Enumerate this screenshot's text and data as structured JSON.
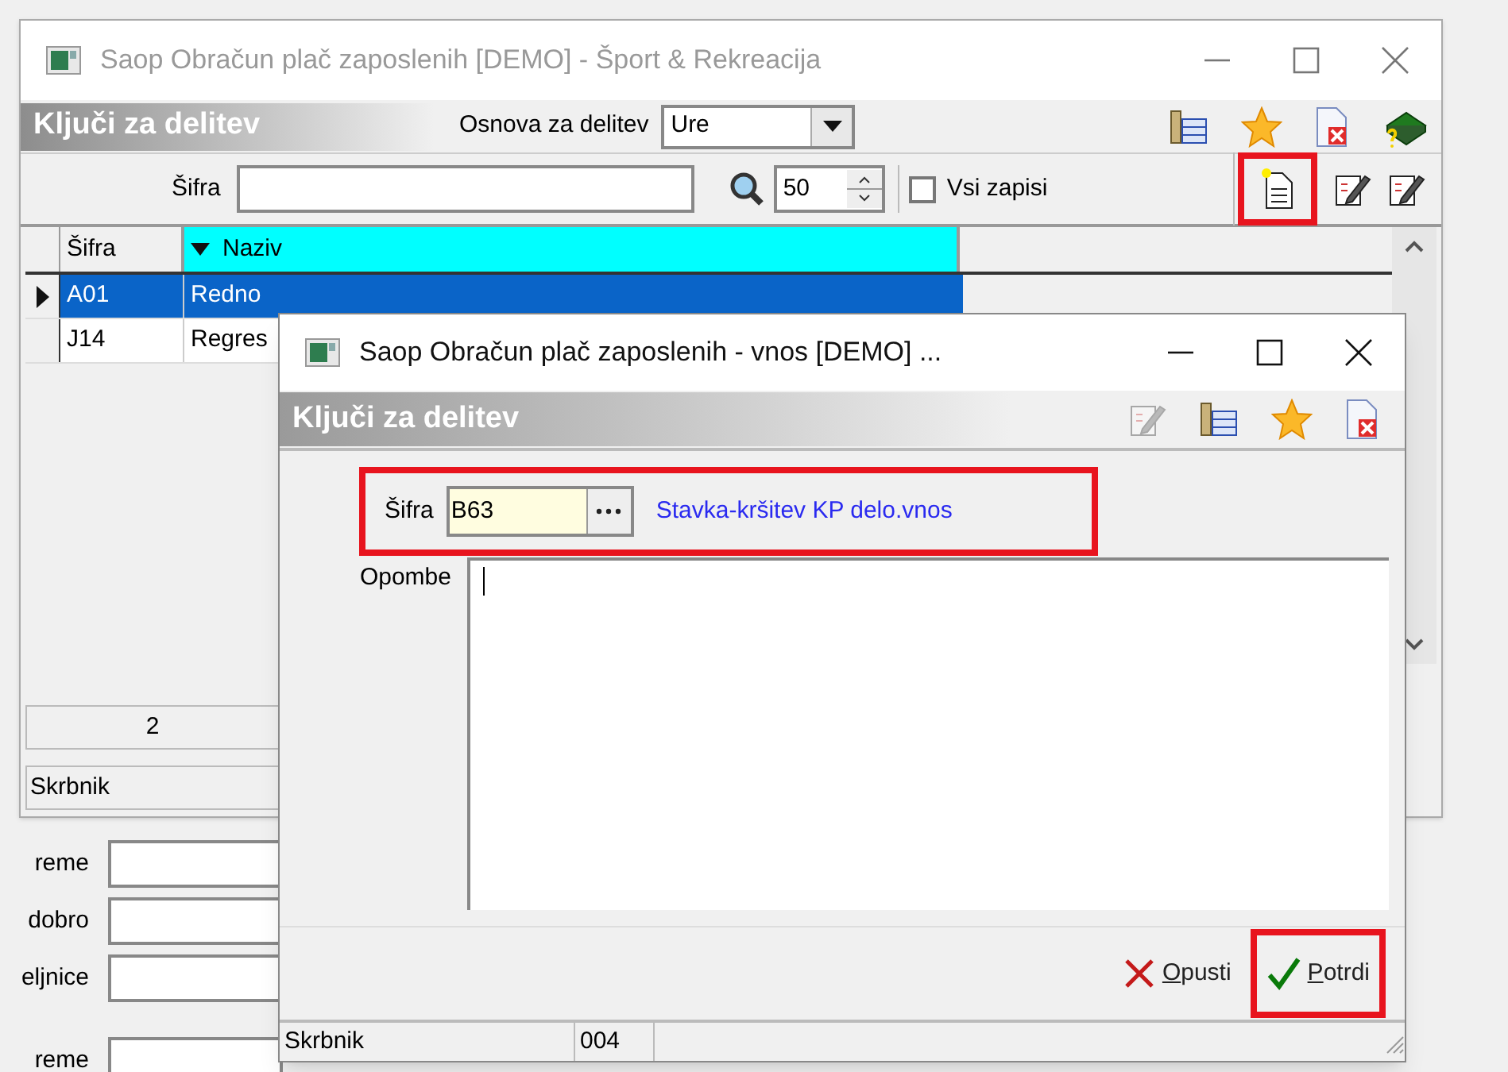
{
  "background_form": {
    "labels": [
      "reme",
      "dobro",
      "eljnice",
      "reme"
    ]
  },
  "main_window": {
    "title": "Saop Obračun plač zaposlenih [DEMO] - Šport & Rekreacija",
    "header": "Ključi za delitev",
    "basis_label": "Osnova za delitev",
    "basis_value": "Ure",
    "search_label": "Šifra",
    "page_size": "50",
    "all_records": {
      "label": "Vsi zapisi",
      "checked": false
    },
    "new_record_highlighted": true,
    "columns": [
      {
        "label": "Šifra",
        "sorted": false
      },
      {
        "label": "Naziv",
        "sorted": true
      }
    ],
    "rows": [
      {
        "code": "A01",
        "name": "Redno",
        "selected": true
      },
      {
        "code": "J14",
        "name": "Regres",
        "selected": false
      }
    ],
    "count": "2",
    "status": "Skrbnik"
  },
  "dialog": {
    "title": "Saop Obračun plač zaposlenih - vnos [DEMO] ...",
    "header": "Ključi za delitev",
    "code_label": "Šifra",
    "code_value": "B63",
    "code_description": "Stavka-kršitev KP delo.vnos",
    "code_highlighted": true,
    "notes_label": "Opombe",
    "buttons": [
      {
        "label": "Opusti",
        "kind": "cancel",
        "highlighted": false
      },
      {
        "label": "Potrdi",
        "kind": "confirm",
        "highlighted": true
      }
    ],
    "status": [
      "Skrbnik",
      "004"
    ]
  }
}
